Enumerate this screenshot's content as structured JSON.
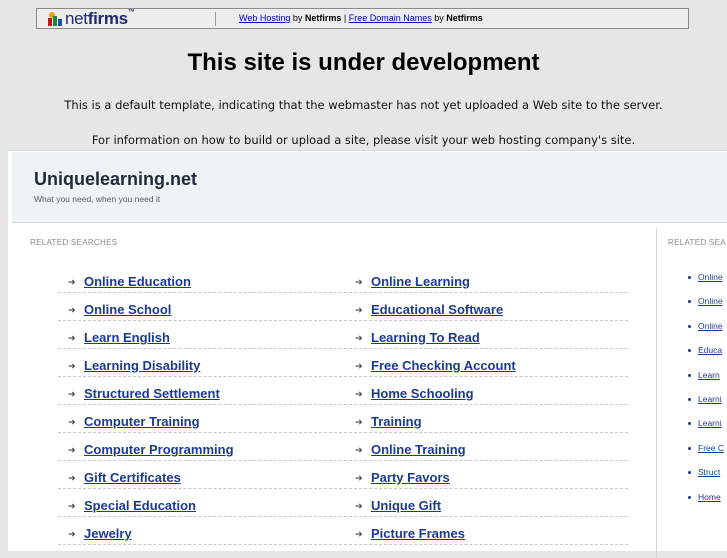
{
  "banner": {
    "logo_text_a": "net",
    "logo_text_b": "firms",
    "logo_tm": "™",
    "link1": "Web Hosting",
    "by1": " by ",
    "brand1": "Netfirms",
    "sep": " | ",
    "link2": "Free Domain Names",
    "by2": " by ",
    "brand2": "Netfirms"
  },
  "headline": "This site is under development",
  "line1": "This is a default template, indicating that the webmaster has not yet uploaded a Web site to the server.",
  "line2": "For information on how to build or upload a site, please visit your web hosting company's site.",
  "site": {
    "title": "Uniquelearning.net",
    "tagline": "What you need, when you need it",
    "corner_mark": "/"
  },
  "related_label": "RELATED SEARCHES",
  "related_label_right": "RELATED SEA",
  "grid": {
    "rows": [
      [
        "Online Education",
        "Online Learning"
      ],
      [
        "Online School",
        "Educational Software"
      ],
      [
        "Learn English",
        "Learning To Read"
      ],
      [
        "Learning Disability",
        "Free Checking Account"
      ],
      [
        "Structured Settlement",
        "Home Schooling"
      ],
      [
        "Computer Training",
        "Training"
      ],
      [
        "Computer Programming",
        "Online Training"
      ],
      [
        "Gift Certificates",
        "Party Favors"
      ],
      [
        "Special Education",
        "Unique Gift"
      ],
      [
        "Jewelry",
        "Picture Frames"
      ]
    ]
  },
  "sidebar": {
    "items": [
      "Online",
      "Online",
      "Online",
      "Educa",
      "Learn",
      "Learni",
      "Learni",
      "Free C",
      "Struct",
      "Home"
    ]
  },
  "colors": {
    "link": "#1a3c8c",
    "background": "#e6e6e6",
    "header_bg": "#eef3f6"
  }
}
